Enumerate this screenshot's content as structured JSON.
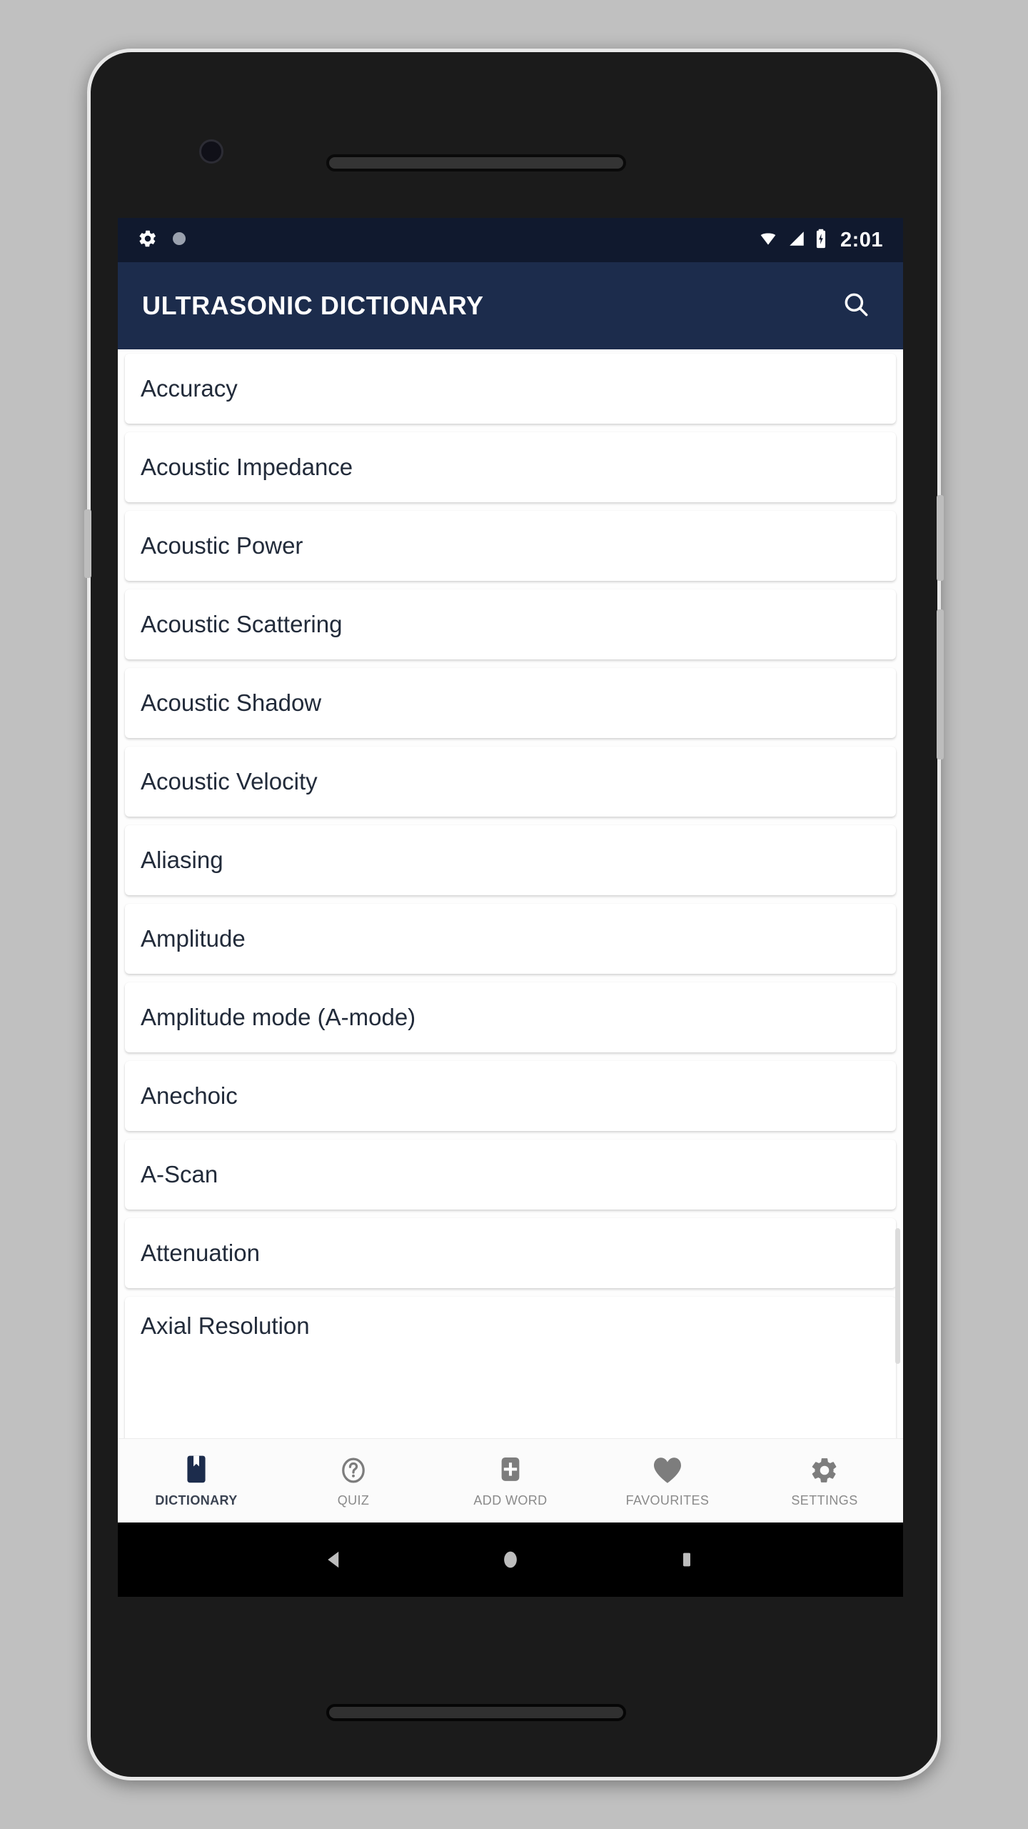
{
  "status_bar": {
    "left_icons": [
      "gear-icon",
      "circle-icon"
    ],
    "right_icons": [
      "wifi-icon",
      "signal-icon",
      "battery-icon"
    ],
    "clock": "2:01",
    "background_color": "#10192e"
  },
  "app_bar": {
    "title": "ULTRASONIC DICTIONARY",
    "search_icon": "search-icon",
    "background_color": "#1c2c4c",
    "text_color": "#ffffff"
  },
  "word_list": {
    "items": [
      {
        "label": "Accuracy"
      },
      {
        "label": "Acoustic Impedance"
      },
      {
        "label": "Acoustic Power"
      },
      {
        "label": "Acoustic Scattering"
      },
      {
        "label": "Acoustic Shadow"
      },
      {
        "label": "Acoustic Velocity"
      },
      {
        "label": "Aliasing"
      },
      {
        "label": "Amplitude"
      },
      {
        "label": "Amplitude mode (A-mode)"
      },
      {
        "label": "Anechoic"
      },
      {
        "label": "A-Scan"
      },
      {
        "label": "Attenuation"
      },
      {
        "label": "Axial Resolution"
      }
    ]
  },
  "bottom_nav": {
    "active_index": 0,
    "active_color": "#1c2c4c",
    "inactive_color": "#7d7d7d",
    "items": [
      {
        "label": "DICTIONARY",
        "icon": "book-icon"
      },
      {
        "label": "QUIZ",
        "icon": "question-circle-icon"
      },
      {
        "label": "ADD WORD",
        "icon": "plus-square-icon"
      },
      {
        "label": "FAVOURITES",
        "icon": "heart-icon"
      },
      {
        "label": "SETTINGS",
        "icon": "gear-icon"
      }
    ]
  },
  "android_nav": {
    "buttons": [
      {
        "name": "back-button",
        "icon": "triangle-left-icon"
      },
      {
        "name": "home-button",
        "icon": "circle-icon"
      },
      {
        "name": "recents-button",
        "icon": "square-icon"
      }
    ]
  }
}
